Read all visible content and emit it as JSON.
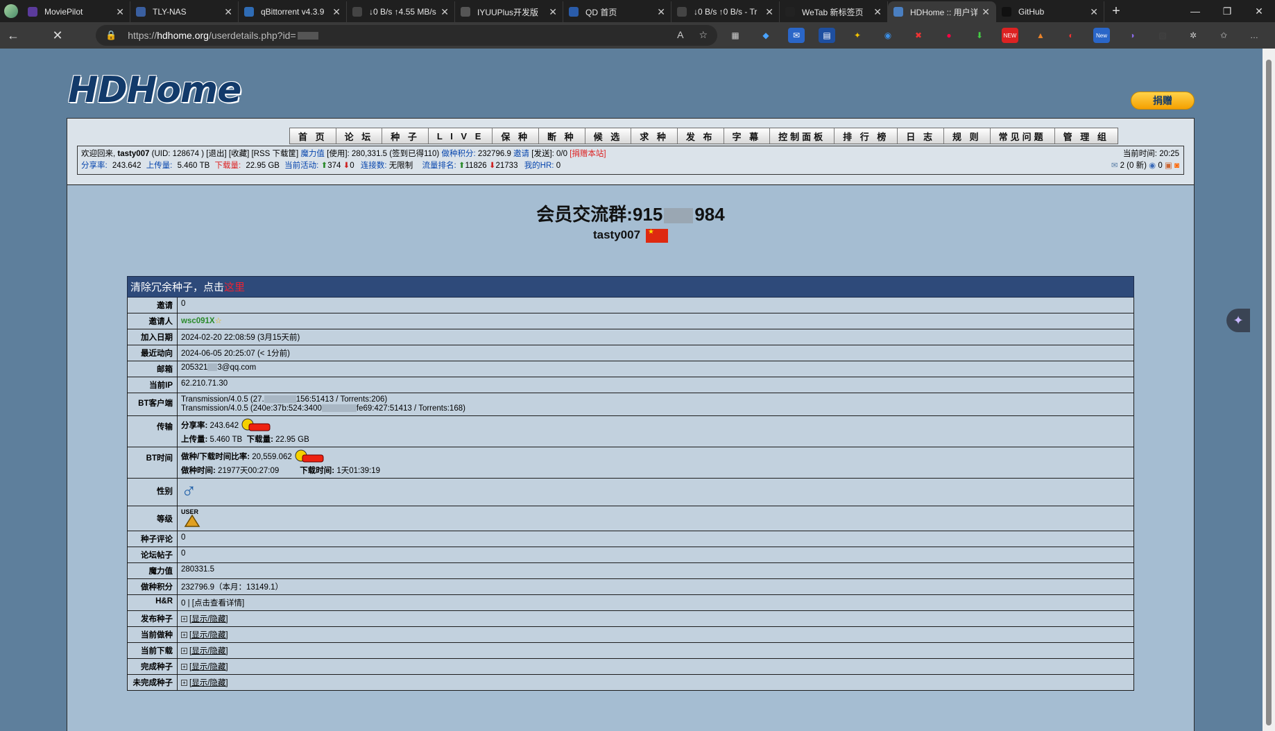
{
  "browser": {
    "tabs": [
      {
        "label": "MoviePilot",
        "fav_color": "#5b3b9c",
        "active": false
      },
      {
        "label": "TLY-NAS",
        "fav_color": "#3a5fa0",
        "active": false
      },
      {
        "label": "qBittorrent v4.3.9",
        "fav_color": "#2f6cb5",
        "active": false
      },
      {
        "label": "↓0 B/s ↑4.55 MB/s",
        "fav_color": "#444444",
        "active": false
      },
      {
        "label": "IYUUPlus开发版",
        "fav_color": "#555555",
        "active": false
      },
      {
        "label": "QD 首页",
        "fav_color": "#2a5caa",
        "active": false
      },
      {
        "label": "↓0 B/s ↑0 B/s - Tr",
        "fav_color": "#444444",
        "active": false
      },
      {
        "label": "WeTab 新标签页",
        "fav_color": "#222222",
        "active": false
      },
      {
        "label": "HDHome :: 用户详",
        "fav_color": "#4a7fc1",
        "active": true
      },
      {
        "label": "GitHub",
        "fav_color": "#111111",
        "active": false
      }
    ],
    "url_prefix": "https://",
    "url_host": "hdhome.org",
    "url_path": "/userdetails.php?id="
  },
  "site": {
    "logo_text": "HDHome",
    "donate_label": "捐赠",
    "nav": [
      "首 页",
      "论 坛",
      "种 子",
      "L I V E",
      "保 种",
      "断 种",
      "候 选",
      "求 种",
      "发 布",
      "字 幕",
      "控制面板",
      "排 行 榜",
      "日 志",
      "规 则",
      "常见问题",
      "管 理 组"
    ]
  },
  "infobar": {
    "welcome": "欢迎回来,",
    "username": "tasty007",
    "uid_text": "(UID: 128674 )",
    "logout": "[退出]",
    "favorites": "[收藏]",
    "rss": "[RSS 下载筐]",
    "magic_label": "魔力值",
    "magic_text": "[使用]: 280,331.5 (签到已得110)",
    "seed_points_label": "做种积分:",
    "seed_points_value": "232796.9",
    "invite_label": "邀请",
    "invite_text": "[发送]: 0/0",
    "donate_link": "[捐赠本站]",
    "ratio_label": "分享率:",
    "ratio_value": "243.642",
    "upload_label": "上传量:",
    "upload_value": "5.460 TB",
    "download_label": "下载量:",
    "download_value": "22.95 GB",
    "active_label": "当前活动:",
    "active_seed": "374",
    "active_leech": "0",
    "conn_label": "连接数:",
    "conn_value": "无限制",
    "rank_label": "流量排名:",
    "rank_up": "11826",
    "rank_down": "21733",
    "hr_label": "我的HR:",
    "hr_value": "0",
    "time_label": "当前时间:",
    "time_value": "20:25",
    "messages": "2 (0 新)",
    "friends": "0"
  },
  "profile": {
    "qq_group_prefix": "会员交流群:915",
    "qq_group_suffix": "984",
    "username": "tasty007",
    "notice": "清除冗余种子，点击",
    "notice_link": "这里",
    "rows": {
      "invites": {
        "label": "邀请",
        "value": "0"
      },
      "inviter": {
        "label": "邀请人",
        "value": "wsc091X"
      },
      "join_date": {
        "label": "加入日期",
        "value": "2024-02-20 22:08:59 (3月15天前)"
      },
      "last_seen": {
        "label": "最近动向",
        "value": "2024-06-05 20:25:07 (< 1分前)"
      },
      "email": {
        "label": "邮箱",
        "prefix": "205321",
        "suffix": "3@qq.com"
      },
      "ip": {
        "label": "当前IP",
        "value": "62.210.71.30"
      },
      "bt_client": {
        "label": "BT客户端",
        "line1_prefix": "Transmission/4.0.5 (27.",
        "line1_suffix": "156:51413 / Torrents:206)",
        "line2_prefix": "Transmission/4.0.5 (240e:37b:524:3400",
        "line2_suffix": "fe69:427:51413 / Torrents:168)"
      },
      "transfer": {
        "label": "传输",
        "ratio_label": "分享率:",
        "ratio_value": "243.642",
        "upload_label": "上传量:",
        "upload_value": "5.460 TB",
        "download_label": "下载量:",
        "download_value": "22.95 GB"
      },
      "bt_time": {
        "label": "BT时间",
        "ratio_label": "做种/下载时间比率:",
        "ratio_value": "20,559.062",
        "seed_label": "做种时间:",
        "seed_value": "21977天00:27:09",
        "leech_label": "下载时间:",
        "leech_value": "1天01:39:19"
      },
      "gender": {
        "label": "性别",
        "symbol": "♂"
      },
      "class": {
        "label": "等级",
        "badge_text": "USER"
      },
      "torrent_comments": {
        "label": "种子评论",
        "value": "0"
      },
      "forum_posts": {
        "label": "论坛帖子",
        "value": "0"
      },
      "bonus": {
        "label": "魔力值",
        "value": "280331.5"
      },
      "seed_points": {
        "label": "做种积分",
        "value": "232796.9（本月：13149.1）"
      },
      "hr": {
        "label": "H&R",
        "value": "0 | [点击查看详情]"
      },
      "uploaded_torrents": {
        "label": "发布种子",
        "value": "[显示/隐藏]"
      },
      "seeding": {
        "label": "当前做种",
        "value": "[显示/隐藏]"
      },
      "leeching": {
        "label": "当前下载",
        "value": "[显示/隐藏]"
      },
      "completed": {
        "label": "完成种子",
        "value": "[显示/隐藏]"
      },
      "incomplete": {
        "label": "未完成种子",
        "value": "[显示/隐藏]"
      }
    }
  }
}
